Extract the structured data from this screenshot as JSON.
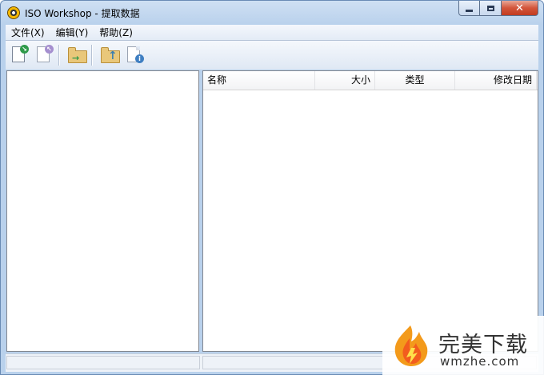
{
  "window": {
    "title": "ISO Workshop - 提取数据",
    "close_glyph": "✕"
  },
  "menu": {
    "items": [
      "文件(X)",
      "编辑(Y)",
      "帮助(Z)"
    ]
  },
  "toolbar": {
    "buttons": [
      "new-document-icon",
      "open-document-icon",
      "extract-folder-icon",
      "up-folder-icon",
      "properties-icon"
    ]
  },
  "file_list": {
    "columns": [
      "名称",
      "大小",
      "类型",
      "修改日期"
    ]
  },
  "watermark": {
    "title": "完美下载",
    "url": "wmzhe.com"
  },
  "colors": {
    "accent": "#3c7fb1",
    "close": "#c23a1f"
  }
}
